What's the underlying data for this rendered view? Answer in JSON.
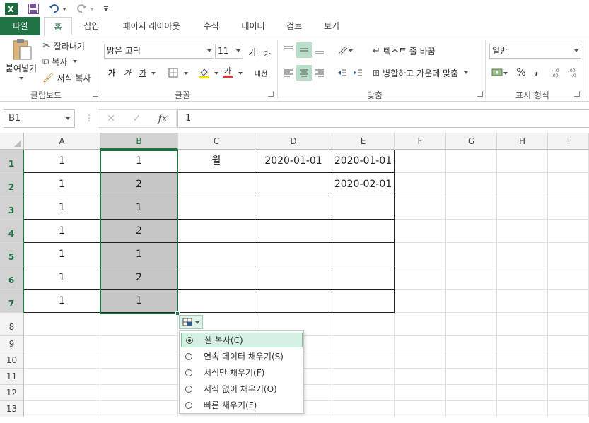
{
  "qat": {
    "app_icon": "excel-icon",
    "save_icon": "save-icon",
    "undo_icon": "undo-icon",
    "redo_icon": "redo-icon",
    "customize_icon": "customize-qat-icon"
  },
  "tabs": [
    "파일",
    "홈",
    "삽입",
    "페이지 레이아웃",
    "수식",
    "데이터",
    "검토",
    "보기"
  ],
  "ribbon": {
    "clipboard": {
      "paste": "붙여넣기",
      "cut": "잘라내기",
      "copy": "복사",
      "format_painter": "서식 복사",
      "label": "클립보드"
    },
    "font": {
      "name": "맑은 고딕",
      "size": "11",
      "grow": "가",
      "shrink": "가",
      "bold": "가",
      "italic": "가",
      "underline": "가",
      "font_color": "가",
      "phonetic": "내천",
      "label": "글꼴"
    },
    "alignment": {
      "wrap_text": "텍스트 줄 바꿈",
      "merge_center": "병합하고 가운데 맞춤",
      "label": "맞춤"
    },
    "number": {
      "format": "일반",
      "percent": "%",
      "comma": ",",
      "label": "표시 형식"
    }
  },
  "formula_bar": {
    "name_box": "B1",
    "formula": "1",
    "fx": "fx"
  },
  "columns": [
    "A",
    "B",
    "C",
    "D",
    "E",
    "F",
    "G",
    "H",
    "I"
  ],
  "rows": [
    "1",
    "2",
    "3",
    "4",
    "5",
    "6",
    "7",
    "8",
    "9",
    "10",
    "11",
    "12",
    "13"
  ],
  "cells": {
    "A": [
      "1",
      "1",
      "1",
      "1",
      "1",
      "1",
      "1"
    ],
    "B": [
      "1",
      "2",
      "1",
      "2",
      "1",
      "2",
      "1"
    ],
    "C": [
      "월",
      "",
      "",
      "",
      "",
      "",
      ""
    ],
    "D": [
      "2020-01-01",
      "",
      "",
      "",
      "",
      "",
      ""
    ],
    "E": [
      "2020-01-01",
      "2020-02-01",
      "",
      "",
      "",
      "",
      ""
    ]
  },
  "autofill_menu": {
    "items": [
      "셀 복사(C)",
      "연속 데이터 채우기(S)",
      "서식만 채우기(F)",
      "서식 없이 채우기(O)",
      "빠른 채우기(F)"
    ],
    "selected_index": 0
  },
  "colors": {
    "accent": "#217346",
    "selection": "#c6c6c6",
    "menu_highlight": "#d3f0e0"
  }
}
